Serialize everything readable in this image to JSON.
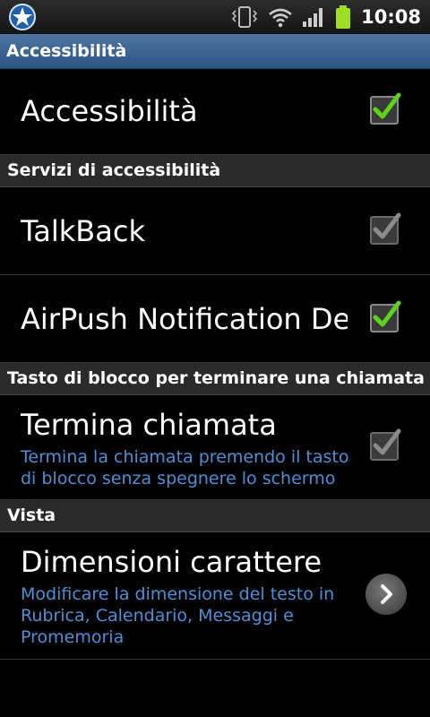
{
  "status_bar": {
    "time": "10:08",
    "icons": [
      "app-star-icon",
      "vibrate-icon",
      "wifi-icon",
      "signal-icon",
      "battery-icon"
    ]
  },
  "title_bar": {
    "title": "Accessibilità"
  },
  "rows": {
    "accessibilita": {
      "title": "Accessibilità",
      "checked": true,
      "enabled": true
    },
    "talkback": {
      "title": "TalkBack",
      "checked": true,
      "enabled": false
    },
    "airpush": {
      "title": "AirPush Notification Detector",
      "checked": true,
      "enabled": true
    },
    "termina": {
      "title": "Termina chiamata",
      "summary": "Termina la chiamata premendo il tasto di blocco senza spegnere lo schermo",
      "checked": true,
      "enabled": false
    },
    "dimensioni": {
      "title": "Dimensioni carattere",
      "summary": "Modificare la dimensione del testo in Rubrica, Calendario, Messaggi e Promemoria"
    }
  },
  "sections": {
    "servizi": "Servizi di accessibilità",
    "tasto": "Tasto di blocco per terminare una chiamata",
    "vista": "Vista"
  },
  "colors": {
    "title_bar": "#3a6491",
    "summary_text": "#4d8fd6",
    "check_green": "#5cd21a"
  }
}
